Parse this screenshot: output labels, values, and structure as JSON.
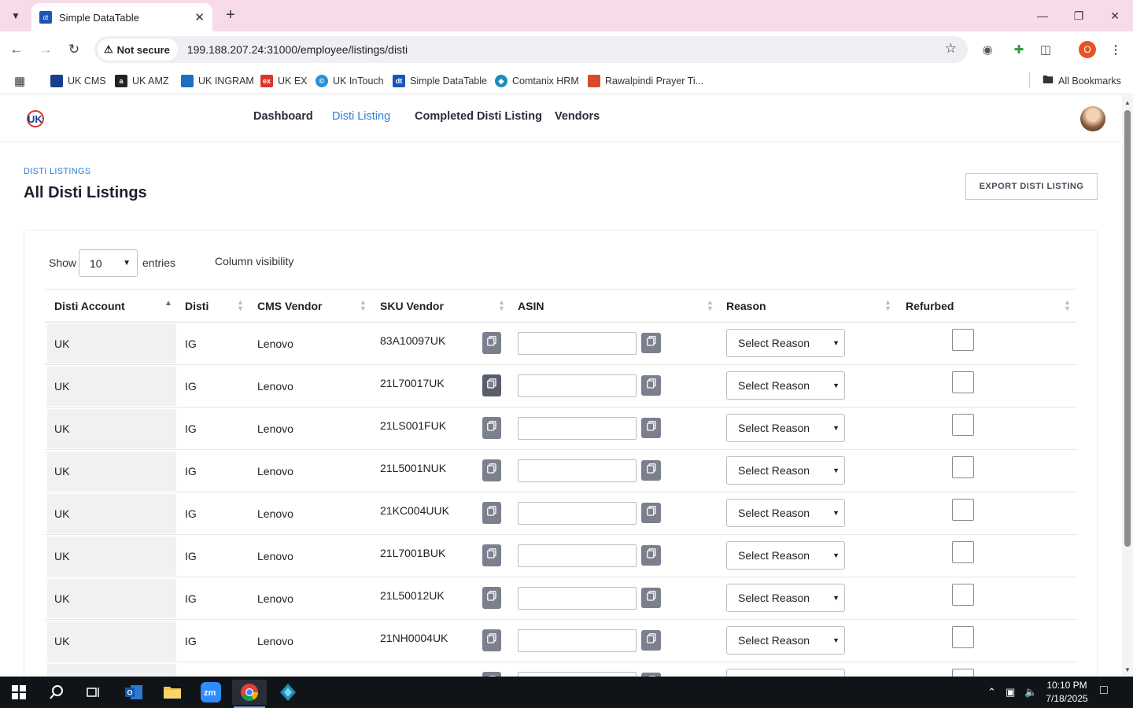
{
  "browser": {
    "tab_title": "Simple DataTable",
    "tab_favicon_text": "dt",
    "security_label": "Not secure",
    "url": "199.188.207.24:31000/employee/listings/disti",
    "profile_initial": "O"
  },
  "bookmarks": [
    {
      "label": "UK CMS",
      "icon_text": "",
      "color": "#1a3e8c"
    },
    {
      "label": "UK AMZ",
      "icon_text": "a",
      "color": "#222222"
    },
    {
      "label": "UK INGRAM",
      "icon_text": "",
      "color": "#1d6fc4"
    },
    {
      "label": "UK EX",
      "icon_text": "ex",
      "color": "#d9362b"
    },
    {
      "label": "UK InTouch",
      "icon_text": "©",
      "color": "#2a8fd6"
    },
    {
      "label": "Simple DataTable",
      "icon_text": "dt",
      "color": "#1a56b8"
    },
    {
      "label": "Comtanix HRM",
      "icon_text": "◆",
      "color": "#1d8fb8"
    },
    {
      "label": "Rawalpindi Prayer Ti...",
      "icon_text": "",
      "color": "#d94a2b"
    }
  ],
  "all_bookmarks_label": "All Bookmarks",
  "nav": {
    "links": [
      "Dashboard",
      "Disti Listing",
      "Completed Disti Listing",
      "Vendors"
    ],
    "active_index": 1
  },
  "header": {
    "eyebrow": "DISTI LISTINGS",
    "title": "All Disti Listings",
    "export_label": "EXPORT DISTI LISTING"
  },
  "controls": {
    "show_label": "Show",
    "entries_value": "10",
    "entries_label": "entries",
    "column_visibility_label": "Column visibility"
  },
  "table": {
    "columns": [
      "Disti Account",
      "Disti",
      "CMS Vendor",
      "SKU Vendor",
      "ASIN",
      "Reason",
      "Refurbed"
    ],
    "reason_placeholder": "Select Reason",
    "rows": [
      {
        "account": "UK",
        "disti": "IG",
        "vendor": "Lenovo",
        "sku": "83A10097UK"
      },
      {
        "account": "UK",
        "disti": "IG",
        "vendor": "Lenovo",
        "sku": "21L70017UK"
      },
      {
        "account": "UK",
        "disti": "IG",
        "vendor": "Lenovo",
        "sku": "21LS001FUK"
      },
      {
        "account": "UK",
        "disti": "IG",
        "vendor": "Lenovo",
        "sku": "21L5001NUK"
      },
      {
        "account": "UK",
        "disti": "IG",
        "vendor": "Lenovo",
        "sku": "21KC004UUK"
      },
      {
        "account": "UK",
        "disti": "IG",
        "vendor": "Lenovo",
        "sku": "21L7001BUK"
      },
      {
        "account": "UK",
        "disti": "IG",
        "vendor": "Lenovo",
        "sku": "21L50012UK"
      },
      {
        "account": "UK",
        "disti": "IG",
        "vendor": "Lenovo",
        "sku": "21NH0004UK"
      },
      {
        "account": "UK",
        "disti": "IG",
        "vendor": "Lenovo",
        "sku": ""
      }
    ]
  },
  "taskbar": {
    "time": "10:10 PM",
    "date": "7/18/2025"
  },
  "colors": {
    "accent": "#2f7fd6",
    "tabstrip": "#f8dbe8",
    "copy_button": "#7b7f8e"
  }
}
